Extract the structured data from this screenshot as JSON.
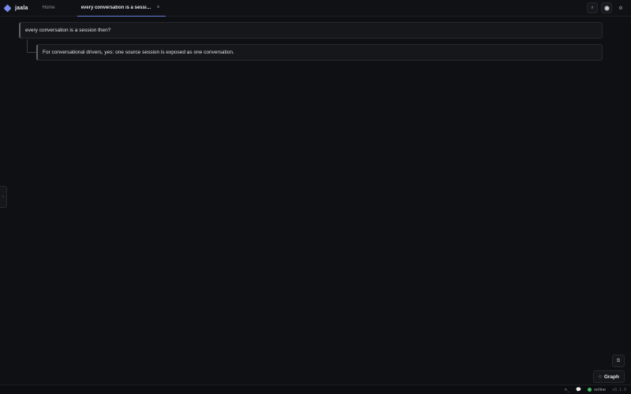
{
  "app": {
    "name": "jaala"
  },
  "tabs": {
    "home_label": "Home",
    "active_label": "every conversation is a session then?",
    "close_glyph": "×"
  },
  "top_actions": {
    "search_glyph": "⌕",
    "settings_glyph": "⚙"
  },
  "thread": {
    "user_message": "every conversation is a session then?",
    "reply_message": "For conversational drivers, yes: one source session is exposed as one conversation."
  },
  "side_handle": {
    "glyph": "›"
  },
  "floating": {
    "copy_glyph": "⧉",
    "graph_label": "Graph",
    "graph_glyph": "◇"
  },
  "statusbar": {
    "terminal_glyph": ">_",
    "chat_glyph": "💬",
    "status_text": "online",
    "status_color": "#3fbf6a",
    "version": "v0.1.0"
  },
  "colors": {
    "accent": "#7b8cf0",
    "background": "#0f1013"
  }
}
